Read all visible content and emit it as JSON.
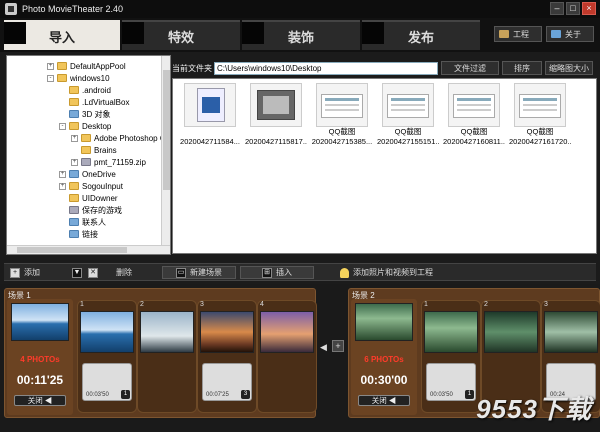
{
  "app": {
    "title": "Photo MovieTheater 2.40"
  },
  "window": {
    "minimize": "–",
    "maximize": "□",
    "close": "×"
  },
  "tabs": [
    {
      "label": "导入",
      "active": true
    },
    {
      "label": "特效",
      "active": false
    },
    {
      "label": "装饰",
      "active": false
    },
    {
      "label": "发布",
      "active": false
    }
  ],
  "topbuttons": {
    "project": "工程",
    "about": "关于"
  },
  "tree": [
    {
      "label": "DefaultAppPool",
      "expander": "+",
      "icon": "folder"
    },
    {
      "label": "windows10",
      "expander": "-",
      "icon": "folder"
    },
    {
      "label": ".android",
      "expander": "",
      "icon": "folder"
    },
    {
      "label": ".LdVirtualBox",
      "expander": "",
      "icon": "folder"
    },
    {
      "label": "3D 对象",
      "expander": "",
      "icon": "folder-blue"
    },
    {
      "label": "Desktop",
      "expander": "-",
      "icon": "folder"
    },
    {
      "label": "Adobe Photoshop C",
      "expander": "+",
      "icon": "folder"
    },
    {
      "label": "Brains",
      "expander": "",
      "icon": "folder"
    },
    {
      "label": "pmt_71159.zip",
      "expander": "+",
      "icon": "folder-gray"
    },
    {
      "label": "OneDrive",
      "expander": "+",
      "icon": "folder-blue"
    },
    {
      "label": "SogouInput",
      "expander": "+",
      "icon": "folder"
    },
    {
      "label": "UIDowner",
      "expander": "",
      "icon": "folder"
    },
    {
      "label": "保存的游戏",
      "expander": "",
      "icon": "folder-gray"
    },
    {
      "label": "联系人",
      "expander": "",
      "icon": "folder-blue"
    },
    {
      "label": "链接",
      "expander": "",
      "icon": "folder-blue"
    }
  ],
  "pathbar": {
    "label": "当前文件夹",
    "path": "C:\\Users\\windows10\\Desktop",
    "filter": "文件过滤",
    "sort": "排序",
    "thumbsize": "缩略图大小"
  },
  "files": [
    {
      "line1": "",
      "line2": "2020042711584...",
      "kind": "video"
    },
    {
      "line1": "",
      "line2": "20200427115817...",
      "kind": "gray"
    },
    {
      "line1": "QQ截图",
      "line2": "2020042715385...",
      "kind": "shot"
    },
    {
      "line1": "QQ截图",
      "line2": "20200427155151...",
      "kind": "shot"
    },
    {
      "line1": "QQ截图",
      "line2": "20200427160811...",
      "kind": "shot"
    },
    {
      "line1": "QQ截图",
      "line2": "20200427161720...",
      "kind": "shot"
    }
  ],
  "toolbar": {
    "add": "添加",
    "del": "删除",
    "newscene": "新建场景",
    "insert": "插入",
    "hint": "添加照片和视频到工程"
  },
  "scenes": [
    {
      "title": "场景 1",
      "photos": "4 PHOTOs",
      "duration": "00:11'25",
      "close": "关闭 ◀",
      "slides": [
        {
          "num": "1",
          "trans_time": "00:03'50",
          "trans_num": "1",
          "pic": "sea"
        },
        {
          "num": "2",
          "trans_time": "",
          "trans_num": "",
          "pic": "sky"
        },
        {
          "num": "3",
          "trans_time": "00:07'25",
          "trans_num": "3",
          "pic": "sunset"
        },
        {
          "num": "4",
          "trans_time": "",
          "trans_num": "",
          "pic": "dusk"
        }
      ]
    },
    {
      "title": "场景 2",
      "photos": "6 PHOTOs",
      "duration": "00:30'00",
      "close": "关闭 ◀",
      "slides": [
        {
          "num": "1",
          "trans_time": "00:03'50",
          "trans_num": "1",
          "pic": "forest"
        },
        {
          "num": "2",
          "trans_time": "",
          "trans_num": "",
          "pic": "river"
        },
        {
          "num": "3",
          "trans_time": "00:24",
          "trans_num": "",
          "pic": "falls"
        }
      ]
    }
  ],
  "watermark": "9553下载"
}
